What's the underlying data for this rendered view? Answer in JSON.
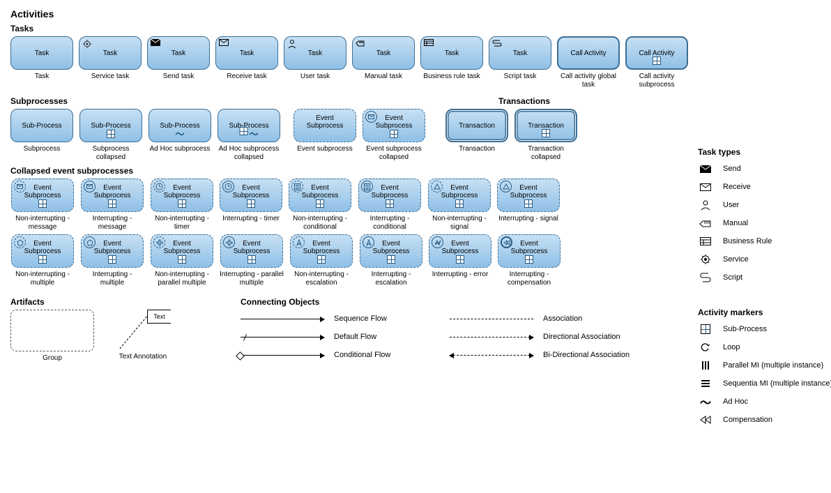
{
  "headings": {
    "activities": "Activities",
    "tasks": "Tasks",
    "subprocesses": "Subprocesses",
    "transactions": "Transactions",
    "collapsed": "Collapsed event subprocesses",
    "artifacts": "Artifacts",
    "connecting": "Connecting Objects",
    "task_types": "Task types",
    "activity_markers": "Activity markers"
  },
  "tasks": [
    {
      "label": "Task",
      "caption": "Task"
    },
    {
      "label": "Task",
      "caption": "Service task"
    },
    {
      "label": "Task",
      "caption": "Send task"
    },
    {
      "label": "Task",
      "caption": "Receive task"
    },
    {
      "label": "Task",
      "caption": "User task"
    },
    {
      "label": "Task",
      "caption": "Manual task"
    },
    {
      "label": "Task",
      "caption": "Business rule task"
    },
    {
      "label": "Task",
      "caption": "Script task"
    },
    {
      "label": "Call Activity",
      "caption": "Call activity global task"
    },
    {
      "label": "Call Activity",
      "caption": "Call activity subprocess"
    }
  ],
  "subprocesses": [
    {
      "label": "Sub-Process",
      "caption": "Subprocess"
    },
    {
      "label": "Sub-Process",
      "caption": "Subprocess collapsed"
    },
    {
      "label": "Sub-Process",
      "caption": "Ad Hoc subprocess"
    },
    {
      "label": "Sub-Process",
      "caption": "Ad Hoc subprocess collapsed"
    }
  ],
  "event_sub": [
    {
      "label": "Event Subprocess",
      "caption": "Event subprocess"
    },
    {
      "label": "Event Subprocess",
      "caption": "Event subprocess collapsed"
    }
  ],
  "transactions": [
    {
      "label": "Transaction",
      "caption": "Transaction"
    },
    {
      "label": "Transaction",
      "caption": "Transaction collapsed"
    }
  ],
  "collapsed1": [
    {
      "label": "Event Subprocess",
      "caption": "Non-interrupting - message"
    },
    {
      "label": "Event Subprocess",
      "caption": "Interrupting - message"
    },
    {
      "label": "Event Subprocess",
      "caption": "Non-interrupting - timer"
    },
    {
      "label": "Event Subprocess",
      "caption": "Interrupting - timer"
    },
    {
      "label": "Event Subprocess",
      "caption": "Non-interrupting - conditional"
    },
    {
      "label": "Event Subprocess",
      "caption": "Interrupting - conditional"
    },
    {
      "label": "Event Subprocess",
      "caption": "Non-interrupting - signal"
    },
    {
      "label": "Event Subprocess",
      "caption": "Interrupting - signal"
    }
  ],
  "collapsed2": [
    {
      "label": "Event Subprocess",
      "caption": "Non-interrupting - multiple"
    },
    {
      "label": "Event Subprocess",
      "caption": "Interrupting - multiple"
    },
    {
      "label": "Event Subprocess",
      "caption": "Non-interrupting - parallel multiple"
    },
    {
      "label": "Event Subprocess",
      "caption": "Interrupting - parallel multiple"
    },
    {
      "label": "Event Subprocess",
      "caption": "Non-interrupting - escalation"
    },
    {
      "label": "Event Subprocess",
      "caption": "Interrupting - escalation"
    },
    {
      "label": "Event Subprocess",
      "caption": "Interrupting - error"
    },
    {
      "label": "Event Subprocess",
      "caption": "Interrupting - compensation"
    }
  ],
  "artifacts": {
    "group": "Group",
    "text_annotation": "Text Annotation",
    "text_label": "Text"
  },
  "connecting": {
    "sequence": "Sequence Flow",
    "default": "Default Flow",
    "conditional": "Conditional Flow",
    "association": "Association",
    "directional": "Directional Association",
    "bidirectional": "Bi-Directional Association"
  },
  "task_types": [
    {
      "name": "Send"
    },
    {
      "name": "Receive"
    },
    {
      "name": "User"
    },
    {
      "name": "Manual"
    },
    {
      "name": "Business Rule"
    },
    {
      "name": "Service"
    },
    {
      "name": "Script"
    }
  ],
  "activity_markers": [
    {
      "name": "Sub-Process"
    },
    {
      "name": "Loop"
    },
    {
      "name": "Parallel MI (multiple instance)"
    },
    {
      "name": "Sequentia MI (multiple instance)"
    },
    {
      "name": "Ad Hoc"
    },
    {
      "name": "Compensation"
    }
  ]
}
